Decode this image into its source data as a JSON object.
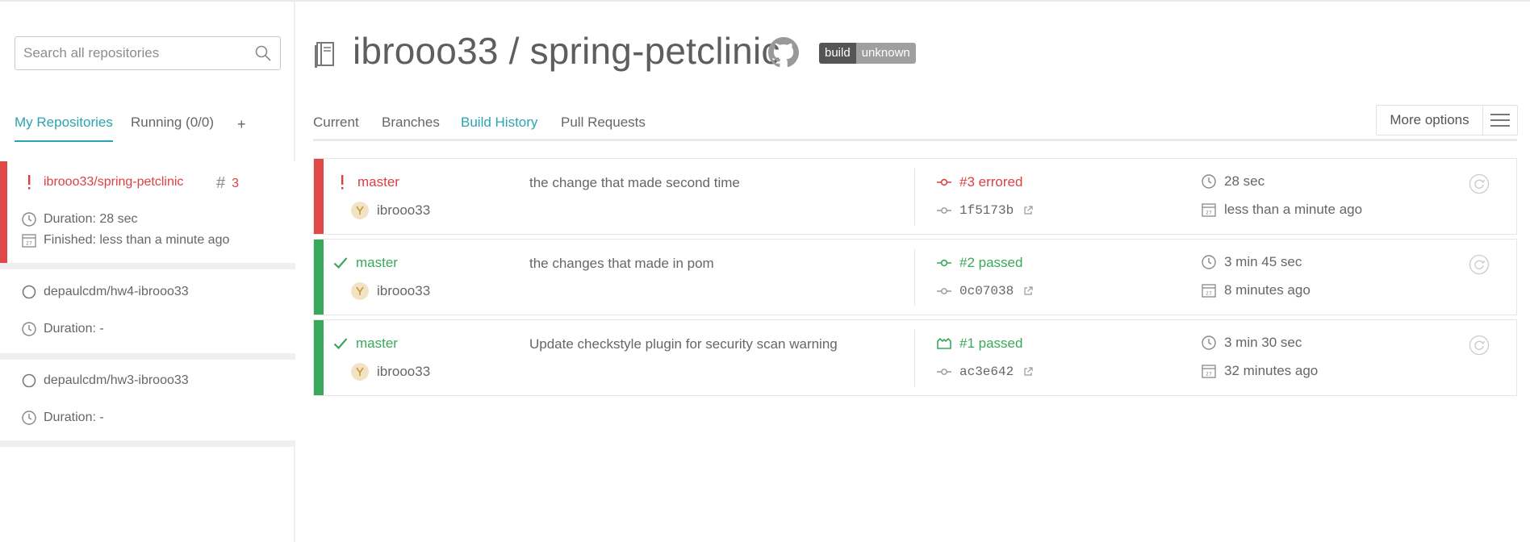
{
  "colors": {
    "accent": "#2aa5b0",
    "error": "#db4141",
    "passed": "#39a85b",
    "text": "#666666"
  },
  "sidebar": {
    "search_placeholder": "Search all repositories",
    "tabs": {
      "my_repos": "My Repositories",
      "running": "Running (0/0)",
      "add": "+"
    },
    "repos": [
      {
        "name": "ibrooo33/spring-petclinic",
        "status": "errored",
        "build_number": "3",
        "duration": "Duration: 28 sec",
        "finished": "Finished: less than a minute ago"
      },
      {
        "name": "depaulcdm/hw4-ibrooo33",
        "status": "none",
        "duration": "Duration: -"
      },
      {
        "name": "depaulcdm/hw3-ibrooo33",
        "status": "none",
        "duration": "Duration: -"
      }
    ]
  },
  "header": {
    "title": "ibrooo33 / spring-petclinic",
    "badge_left": "build",
    "badge_right": "unknown"
  },
  "tabs": {
    "current": "Current",
    "branches": "Branches",
    "build_history": "Build History",
    "pull_requests": "Pull Requests"
  },
  "more_options": "More options",
  "builds": [
    {
      "status": "errored",
      "branch": "master",
      "author": "ibrooo33",
      "message": "the change that made second time",
      "number_label": "#3 errored",
      "commit": "1f5173b",
      "duration": "28 sec",
      "when": "less than a minute ago"
    },
    {
      "status": "passed",
      "branch": "master",
      "author": "ibrooo33",
      "message": "the changes that made in pom",
      "number_label": "#2 passed",
      "commit": "0c07038",
      "duration": "3 min 45 sec",
      "when": "8 minutes ago"
    },
    {
      "status": "passed",
      "branch": "master",
      "author": "ibrooo33",
      "message": "Update checkstyle plugin for security scan warning",
      "number_label": "#1 passed",
      "commit": "ac3e642",
      "duration": "3 min 30 sec",
      "when": "32 minutes ago"
    }
  ]
}
